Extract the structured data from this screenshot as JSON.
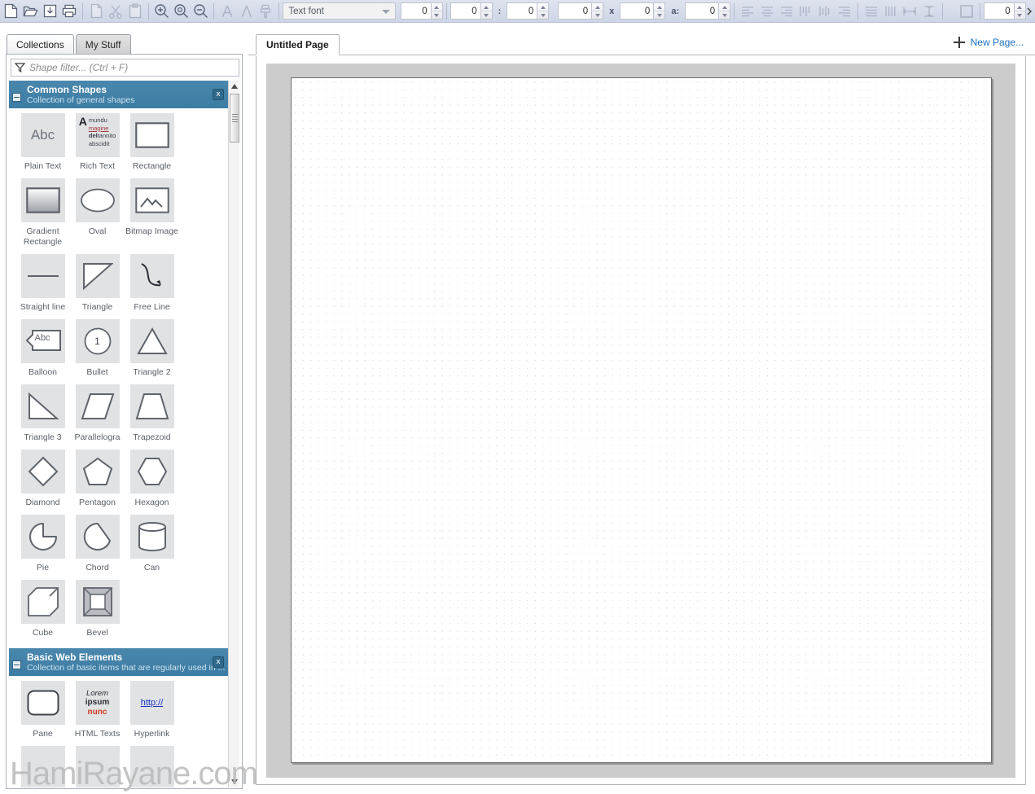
{
  "toolbar": {
    "groups": [
      {
        "name": "file",
        "items": [
          {
            "icon": "new-document-icon",
            "label": "New",
            "enabled": true
          },
          {
            "icon": "open-folder-icon",
            "label": "Open",
            "enabled": true
          },
          {
            "icon": "save-icon",
            "label": "Save",
            "enabled": true
          },
          {
            "icon": "print-icon",
            "label": "Print",
            "enabled": true
          }
        ]
      },
      {
        "name": "clipboard",
        "items": [
          {
            "icon": "copy-icon",
            "label": "Copy",
            "enabled": false
          },
          {
            "icon": "cut-scissors-icon",
            "label": "Cut",
            "enabled": false
          },
          {
            "icon": "paste-icon",
            "label": "Paste",
            "enabled": false
          }
        ]
      },
      {
        "name": "zoom",
        "items": [
          {
            "icon": "zoom-in-icon",
            "label": "Zoom In",
            "enabled": true
          },
          {
            "icon": "zoom-fit-icon",
            "label": "Zoom To Fit",
            "enabled": true
          },
          {
            "icon": "zoom-out-icon",
            "label": "Zoom Out",
            "enabled": true
          }
        ]
      },
      {
        "name": "text-style",
        "items": [
          {
            "icon": "font-color-icon",
            "label": "Font Color",
            "enabled": false
          },
          {
            "icon": "font-style-icon",
            "label": "Font Style",
            "enabled": false
          },
          {
            "icon": "format-painter-icon",
            "label": "Format Painter",
            "enabled": false
          }
        ]
      }
    ],
    "font_combo": {
      "value": "Text font",
      "placeholder": "Text font"
    },
    "font_size": "0",
    "position": {
      "x": "0",
      "separator": ":",
      "y": "0"
    },
    "size": {
      "width": "0",
      "separator": "x",
      "height": "0"
    },
    "angle": {
      "separator": "a:",
      "value": "0"
    },
    "align_items": [
      {
        "icon": "align-left-icon",
        "label": "Align Left",
        "enabled": false
      },
      {
        "icon": "align-center-icon",
        "label": "Align Center",
        "enabled": false
      },
      {
        "icon": "align-right-icon",
        "label": "Align Right",
        "enabled": false
      },
      {
        "icon": "align-top-icon",
        "label": "Align Top",
        "enabled": false
      },
      {
        "icon": "align-middle-icon",
        "label": "Align Middle",
        "enabled": false
      },
      {
        "icon": "align-bottom-icon",
        "label": "Align Bottom",
        "enabled": false
      }
    ],
    "distribute_items": [
      {
        "icon": "distribute-rows-icon",
        "label": "Distribute Rows",
        "enabled": false
      },
      {
        "icon": "distribute-columns-icon",
        "label": "Distribute Columns",
        "enabled": false
      },
      {
        "icon": "same-width-icon",
        "label": "Same Width",
        "enabled": false
      },
      {
        "icon": "same-height-icon",
        "label": "Same Height",
        "enabled": false
      }
    ],
    "shape_fill": {
      "icon": "shape-fill-icon",
      "label": "Shape Fill",
      "enabled": false
    },
    "line_width": "0"
  },
  "sidebar": {
    "tabs": [
      {
        "label": "Collections",
        "active": true
      },
      {
        "label": "My Stuff",
        "active": false
      }
    ],
    "filter": {
      "placeholder": "Shape filter... (Ctrl + F)",
      "value": "",
      "icon": "filter-funnel-icon"
    },
    "groups": [
      {
        "title": "Common Shapes",
        "subtitle": "Collection of general shapes",
        "shapes": [
          {
            "label": "Plain Text",
            "icon": "plain-text-shape"
          },
          {
            "label": "Rich Text",
            "icon": "rich-text-shape"
          },
          {
            "label": "Rectangle",
            "icon": "rectangle-shape"
          },
          {
            "label": "Gradient Rectangle",
            "icon": "gradient-rectangle-shape"
          },
          {
            "label": "Oval",
            "icon": "oval-shape"
          },
          {
            "label": "Bitmap Image",
            "icon": "bitmap-image-shape"
          },
          {
            "label": "Straight line",
            "icon": "straight-line-shape"
          },
          {
            "label": "Triangle",
            "icon": "triangle-shape"
          },
          {
            "label": "Free Line",
            "icon": "free-line-shape"
          },
          {
            "label": "Balloon",
            "icon": "balloon-shape"
          },
          {
            "label": "Bullet",
            "icon": "bullet-shape"
          },
          {
            "label": "Triangle 2",
            "icon": "triangle-2-shape"
          },
          {
            "label": "Triangle 3",
            "icon": "triangle-3-shape"
          },
          {
            "label": "Parallelogra",
            "icon": "parallelogram-shape"
          },
          {
            "label": "Trapezoid",
            "icon": "trapezoid-shape"
          },
          {
            "label": "Diamond",
            "icon": "diamond-shape"
          },
          {
            "label": "Pentagon",
            "icon": "pentagon-shape"
          },
          {
            "label": "Hexagon",
            "icon": "hexagon-shape"
          },
          {
            "label": "Pie",
            "icon": "pie-shape"
          },
          {
            "label": "Chord",
            "icon": "chord-shape"
          },
          {
            "label": "Can",
            "icon": "can-shape"
          },
          {
            "label": "Cube",
            "icon": "cube-shape"
          },
          {
            "label": "Bevel",
            "icon": "bevel-shape"
          }
        ],
        "rich_text_preview": {
          "big_letter": "A",
          "line1": "mundu",
          "line2": "magine",
          "line3_bold": "del",
          "line3": "tannito",
          "line4": "abscidit"
        },
        "plain_text_preview": "Abc",
        "balloon_preview": "Abc",
        "bullet_preview": "1"
      },
      {
        "title": "Basic Web Elements",
        "subtitle": "Collection of basic items that are regularly used in ...",
        "shapes": [
          {
            "label": "Pane",
            "icon": "pane-shape"
          },
          {
            "label": "HTML Texts",
            "icon": "html-texts-shape"
          },
          {
            "label": "Hyperlink",
            "icon": "hyperlink-shape"
          }
        ],
        "html_text_preview": {
          "line1": "Lorem",
          "line2": "ipsum",
          "line3": "nunc"
        },
        "hyperlink_preview": "http://"
      }
    ],
    "close_button_label": "x",
    "collapse_button_label": "-"
  },
  "workspace": {
    "page_tabs": [
      {
        "label": "Untitled Page",
        "active": true
      }
    ],
    "new_page_label": "New Page...",
    "new_page_icon": "plus-icon"
  },
  "watermark": "HamiRayane.com",
  "colors": {
    "group_header": "#3c7ca3",
    "link": "#1a6fc4",
    "toolbar_bg": "#d6dcea",
    "canvas_mat": "#cccccc",
    "rich_text_accent": "#a33a3a"
  }
}
